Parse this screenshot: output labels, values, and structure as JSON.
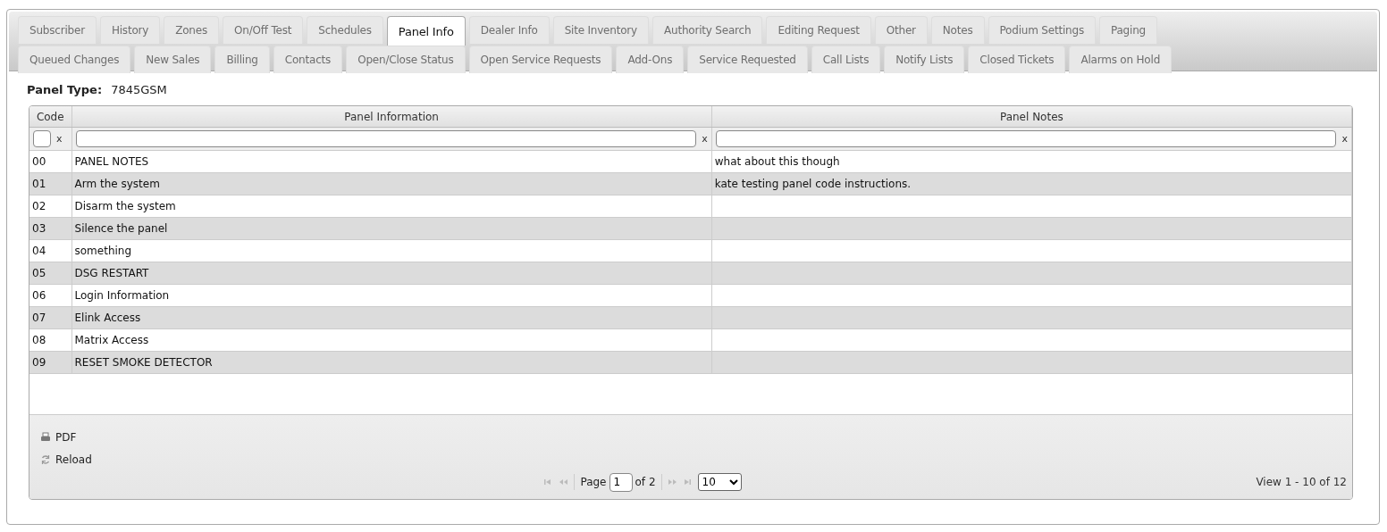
{
  "tab_rows": [
    {
      "tabs": [
        {
          "label": "Subscriber",
          "selected": false
        },
        {
          "label": "History",
          "selected": false
        },
        {
          "label": "Zones",
          "selected": false
        },
        {
          "label": "On/Off Test",
          "selected": false
        },
        {
          "label": "Schedules",
          "selected": false
        },
        {
          "label": "Panel Info",
          "selected": true
        },
        {
          "label": "Dealer Info",
          "selected": false
        },
        {
          "label": "Site Inventory",
          "selected": false
        },
        {
          "label": "Authority Search",
          "selected": false
        },
        {
          "label": "Editing Request",
          "selected": false
        },
        {
          "label": "Other",
          "selected": false
        },
        {
          "label": "Notes",
          "selected": false
        },
        {
          "label": "Podium Settings",
          "selected": false
        },
        {
          "label": "Paging",
          "selected": false
        }
      ]
    },
    {
      "tabs": [
        {
          "label": "Queued Changes",
          "selected": false
        },
        {
          "label": "New Sales",
          "selected": false
        },
        {
          "label": "Billing",
          "selected": false
        },
        {
          "label": "Contacts",
          "selected": false
        },
        {
          "label": "Open/Close Status",
          "selected": false
        },
        {
          "label": "Open Service Requests",
          "selected": false
        },
        {
          "label": "Add-Ons",
          "selected": false
        },
        {
          "label": "Service Requested",
          "selected": false
        },
        {
          "label": "Call Lists",
          "selected": false
        },
        {
          "label": "Notify Lists",
          "selected": false
        },
        {
          "label": "Closed Tickets",
          "selected": false
        },
        {
          "label": "Alarms on Hold",
          "selected": false
        }
      ]
    }
  ],
  "panel_type": {
    "label": "Panel Type:",
    "value": "7845GSM"
  },
  "grid": {
    "columns": [
      {
        "label": "Code"
      },
      {
        "label": "Panel Information"
      },
      {
        "label": "Panel Notes"
      }
    ],
    "filters": [
      {
        "clear": "x"
      },
      {
        "clear": "x"
      },
      {
        "clear": "x"
      }
    ],
    "rows": [
      {
        "code": "00",
        "information": "PANEL NOTES",
        "notes": "what about this though"
      },
      {
        "code": "01",
        "information": "Arm the system",
        "notes": "kate testing panel code instructions."
      },
      {
        "code": "02",
        "information": "Disarm the system"
      },
      {
        "code": "03",
        "information": "Silence the panel"
      },
      {
        "code": "04",
        "information": "something"
      },
      {
        "code": "05",
        "information": "DSG RESTART"
      },
      {
        "code": "06",
        "information": "Login Information"
      },
      {
        "code": "07",
        "information": "Elink Access"
      },
      {
        "code": "08",
        "information": "Matrix Access"
      },
      {
        "code": "09",
        "information": "RESET SMOKE DETECTOR"
      }
    ],
    "actions": [
      {
        "label": "PDF",
        "kind": "pdf"
      },
      {
        "label": "Reload",
        "kind": "reload"
      }
    ],
    "pager": {
      "page_label": "Page",
      "page": "1",
      "of_label": "of 2",
      "page_size": "10",
      "view": "View 1 - 10 of 12"
    }
  }
}
